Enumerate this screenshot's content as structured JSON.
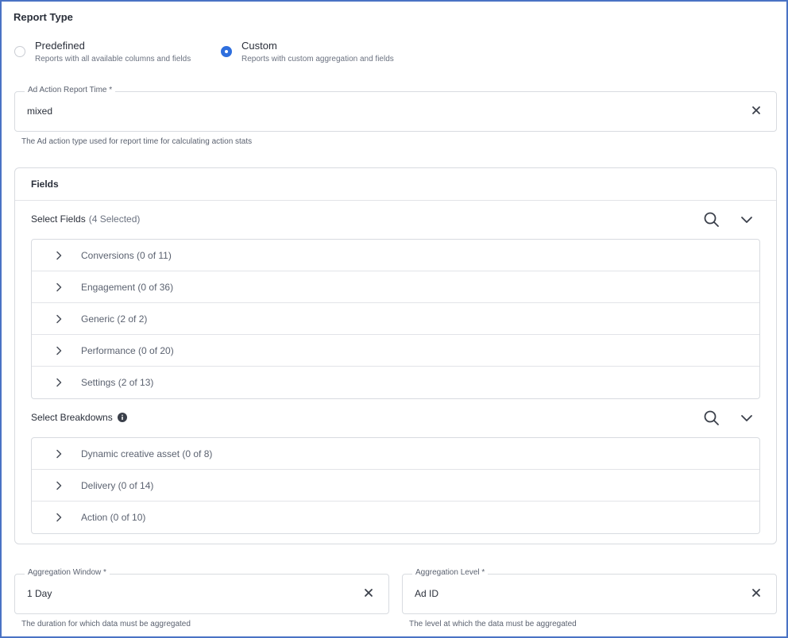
{
  "report_type": {
    "title": "Report Type",
    "options": [
      {
        "label": "Predefined",
        "description": "Reports with all available columns and fields",
        "selected": false
      },
      {
        "label": "Custom",
        "description": "Reports with custom aggregation and fields",
        "selected": true
      }
    ]
  },
  "ad_action_report_time": {
    "label": "Ad Action Report Time *",
    "value": "mixed",
    "helper": "The Ad action type used for report time for calculating action stats"
  },
  "fields_card": {
    "title": "Fields",
    "select_fields": {
      "label": "Select Fields",
      "count": "(4 Selected)",
      "groups": [
        {
          "label": "Conversions (0 of 11)"
        },
        {
          "label": "Engagement (0 of 36)"
        },
        {
          "label": "Generic (2 of 2)"
        },
        {
          "label": "Performance (0 of 20)"
        },
        {
          "label": "Settings (2 of 13)"
        }
      ]
    },
    "select_breakdowns": {
      "label": "Select Breakdowns",
      "groups": [
        {
          "label": "Dynamic creative asset (0 of 8)"
        },
        {
          "label": "Delivery (0 of 14)"
        },
        {
          "label": "Action (0 of 10)"
        }
      ]
    }
  },
  "aggregation_window": {
    "label": "Aggregation Window *",
    "value": "1 Day",
    "helper": "The duration for which data must be aggregated"
  },
  "aggregation_level": {
    "label": "Aggregation Level *",
    "value": "Ad ID",
    "helper": "The level at which the data must be aggregated"
  },
  "colors": {
    "accent": "#2f6fde",
    "frame_border": "#4a72c4",
    "text": "#2a2f3a",
    "muted": "#6b7280"
  },
  "icons": {
    "clear": "close-icon",
    "search": "search-icon",
    "collapse": "chevron-down-icon",
    "expand": "chevron-right-icon",
    "info": "info-icon"
  }
}
